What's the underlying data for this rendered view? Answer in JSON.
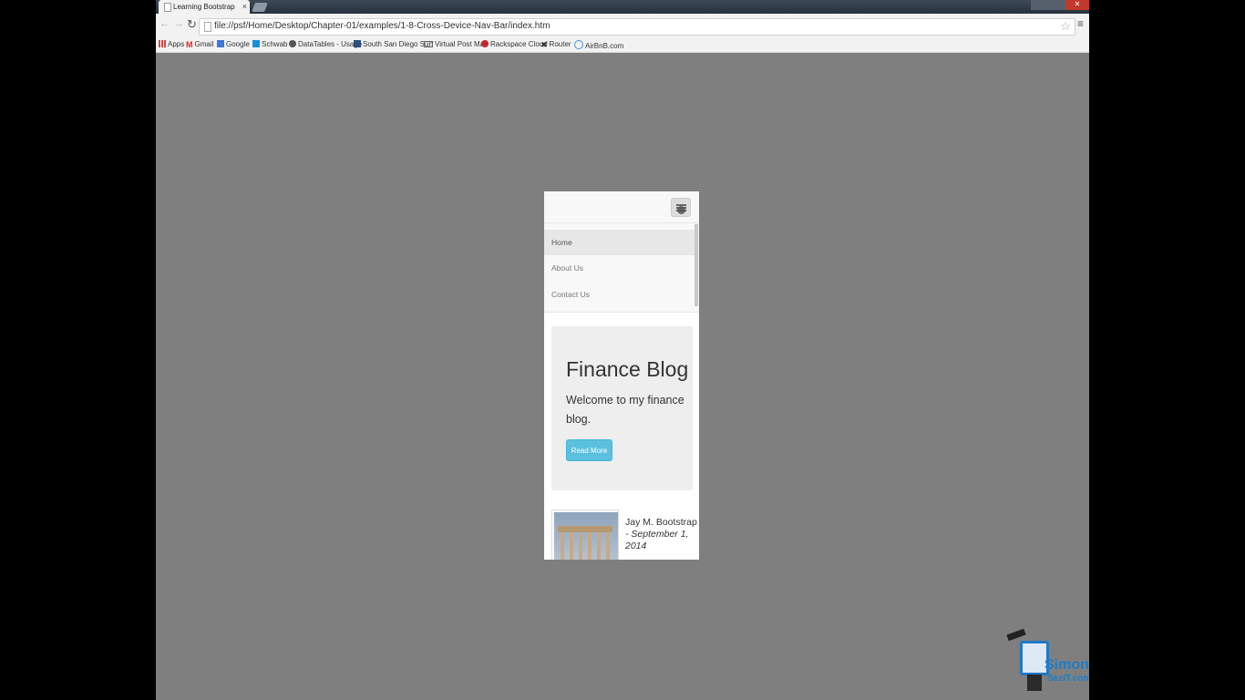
{
  "browser": {
    "tab_title": "Learning Bootstrap",
    "tab_close": "×",
    "url": "file://psf/Home/Desktop/Chapter-01/examples/1-8-Cross-Device-Nav-Bar/index.htm",
    "bookmarks": [
      {
        "label": "Apps",
        "icon": "apps-grid-icon"
      },
      {
        "label": "Gmail",
        "icon": "gmail-icon"
      },
      {
        "label": "Google",
        "icon": "google-icon"
      },
      {
        "label": "Schwab",
        "icon": "schwab-icon"
      },
      {
        "label": "DataTables - Usage",
        "icon": "datatables-icon"
      },
      {
        "label": "South San Diego Surf",
        "icon": "surf-icon"
      },
      {
        "label": "Virtual Post Mail",
        "icon": "mail-icon"
      },
      {
        "label": "Rackspace Cloud",
        "icon": "rackspace-icon"
      },
      {
        "label": "Router",
        "icon": "router-icon"
      },
      {
        "label": "AirBnB.com",
        "icon": "airbnb-icon"
      }
    ]
  },
  "page": {
    "nav_items": [
      {
        "label": "Home",
        "active": true
      },
      {
        "label": "About Us",
        "active": false
      },
      {
        "label": "Contact Us",
        "active": false
      }
    ],
    "jumbotron": {
      "title": "Finance Blog",
      "text": "Welcome to my finance blog.",
      "button": "Read More"
    },
    "post": {
      "author": "Jay M. Bootstrap",
      "date": "- September 1, 2014"
    }
  },
  "watermark": {
    "name": "Simon",
    "domain": "SezIT.com"
  },
  "colors": {
    "page_background": "#7f7f7f",
    "button_info": "#5bc0de",
    "logo_blue": "#1d7ec9"
  }
}
